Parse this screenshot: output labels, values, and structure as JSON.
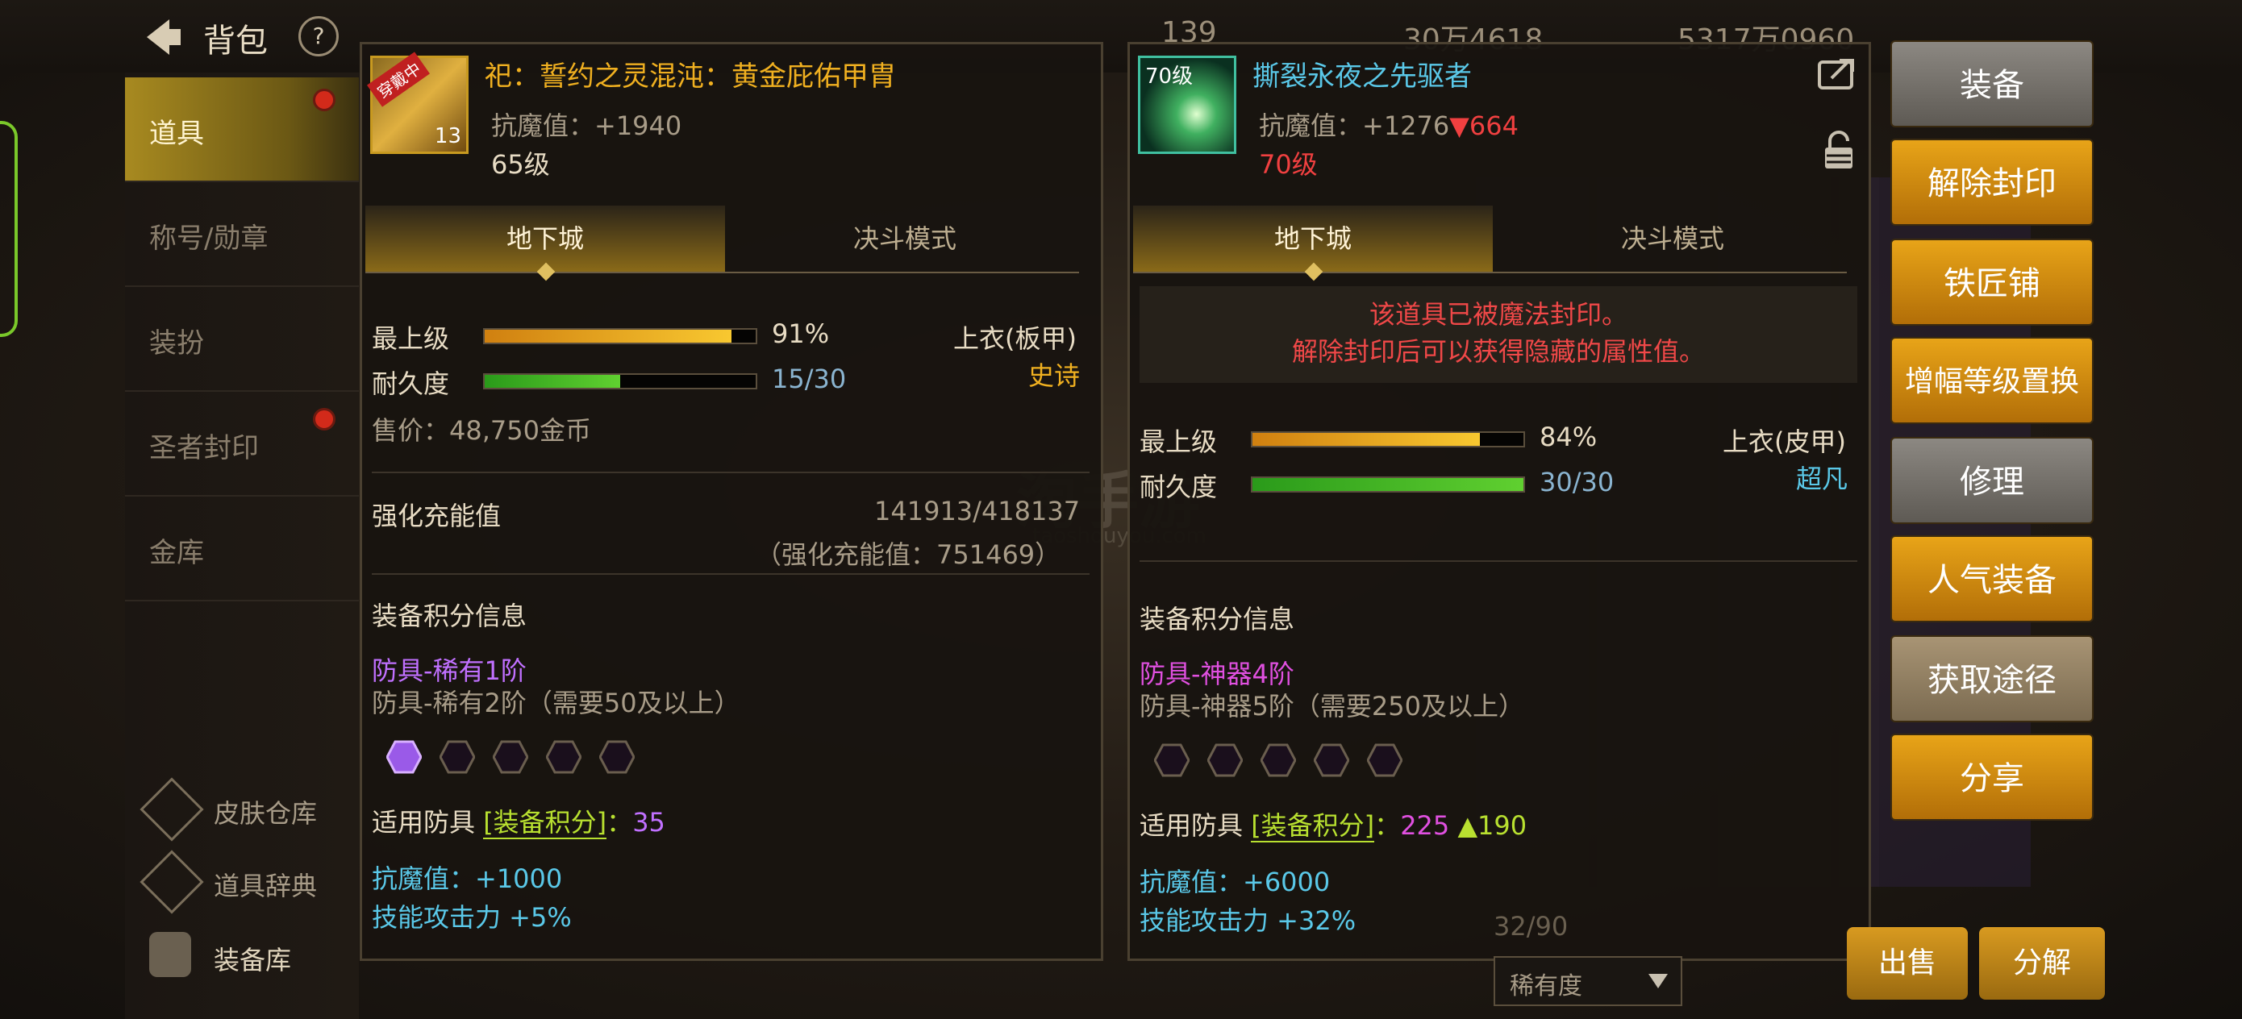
{
  "topbar": {
    "title": "背包",
    "help": "?",
    "currency_1": "139",
    "currency_2": "30万4618",
    "currency_3": "5317万0960"
  },
  "sidebar": {
    "items": [
      {
        "label": "道具",
        "badge": true
      },
      {
        "label": "称号/勋章",
        "badge": false
      },
      {
        "label": "装扮",
        "badge": false
      },
      {
        "label": "圣者封印",
        "badge": true
      },
      {
        "label": "金库",
        "badge": false
      }
    ],
    "tools": [
      "皮肤仓库",
      "道具辞典",
      "装备库"
    ]
  },
  "left_item": {
    "icon_tag": "穿戴中",
    "icon_level": "13",
    "name": "祀：誓约之灵混沌：黄金庇佑甲胄",
    "magic_resist": "抗魔值：+1940",
    "level": "65级",
    "tabs": [
      "地下城",
      "决斗模式"
    ],
    "top_level_label": "最上级",
    "top_level_value": "91%",
    "top_level_fraction": 0.91,
    "durability_label": "耐久度",
    "durability_value": "15/30",
    "durability_fraction": 0.5,
    "slot": "上衣(板甲)",
    "rarity": "史诗",
    "price": "售价：48,750金币",
    "reinforce_label": "强化充能值",
    "reinforce_value": "141913/418137",
    "reinforce_total": "（强化充能值：751469）",
    "score_header": "装备积分信息",
    "tier_current": "防具-稀有1阶",
    "tier_next": "防具-稀有2阶（需要50及以上）",
    "gems_filled": 1,
    "gems_total": 5,
    "score_prefix": "适用防具",
    "score_bracket": "[装备积分]",
    "score_colon": "：",
    "score_value": "35",
    "bonus_1": "抗魔值：+1000",
    "bonus_2": "技能攻击力 +5%"
  },
  "right_item": {
    "icon_level_text": "70级",
    "name": "撕裂永夜之先驱者",
    "magic_resist": "抗魔值：+1276",
    "magic_resist_diff": "▼664",
    "level": "70级",
    "tabs": [
      "地下城",
      "决斗模式"
    ],
    "sealed_line1": "该道具已被魔法封印。",
    "sealed_line2": "解除封印后可以获得隐藏的属性值。",
    "top_level_label": "最上级",
    "top_level_value": "84%",
    "top_level_fraction": 0.84,
    "durability_label": "耐久度",
    "durability_value": "30/30",
    "durability_fraction": 1.0,
    "slot": "上衣(皮甲)",
    "rarity": "超凡",
    "score_header": "装备积分信息",
    "tier_current": "防具-神器4阶",
    "tier_next": "防具-神器5阶（需要250及以上）",
    "gems_filled": 0,
    "gems_total": 5,
    "score_prefix": "适用防具",
    "score_bracket": "[装备积分]",
    "score_colon": "：",
    "score_value": "225",
    "score_diff": "▲190",
    "bonus_1": "抗魔值：+6000",
    "bonus_2": "技能攻击力 +32%"
  },
  "actions": [
    "装备",
    "解除封印",
    "铁匠铺",
    "增幅等级置换",
    "修理",
    "人气装备",
    "获取途径",
    "分享"
  ],
  "bottom": {
    "sell": "出售",
    "disassemble": "分解",
    "rarity_filter": "稀有度",
    "count": "32/90"
  },
  "watermark": {
    "text": "淘手游",
    "sub": "taoshouyou.com"
  },
  "colors": {
    "gold": "#f0b020",
    "green": "#b8e030",
    "purple": "#c070ff",
    "magenta": "#e050e0",
    "cyan": "#5ac8e8",
    "red": "#f04040"
  }
}
